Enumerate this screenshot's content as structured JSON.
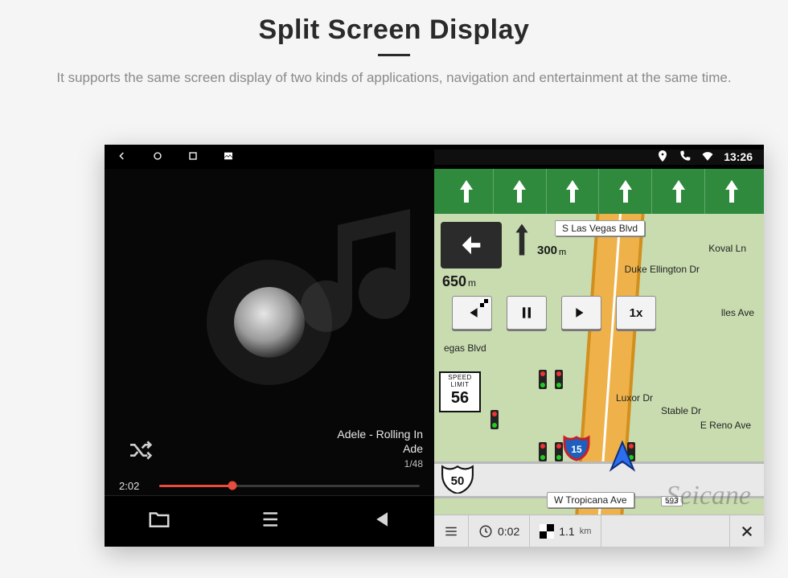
{
  "header": {
    "title": "Split Screen Display",
    "subtitle": "It supports the same screen display of two kinds of applications, navigation and entertainment at the same time."
  },
  "statusbar": {
    "time": "13:26"
  },
  "music": {
    "track_line1": "Adele - Rolling In",
    "track_line2": "Ade",
    "index": "1/48",
    "elapsed": "2:02"
  },
  "nav": {
    "street_top": "S Las Vegas Blvd",
    "street_bottom": "W Tropicana Ave",
    "exit_number": "593",
    "poi_1": "Duke Ellington Dr",
    "poi_2": "Koval Ln",
    "poi_3": "Luxor Dr",
    "poi_4": "E Reno Ave",
    "poi_5": "Stable Dr",
    "poi_6": "lles Ave",
    "poi_7": "egas Blvd",
    "turn_next_distance": "300",
    "turn_next_unit": "m",
    "turn_main_distance": "650",
    "turn_main_unit": "m",
    "speed_limit_label": "SPEED LIMIT",
    "speed_limit_value": "56",
    "route_shield": "50",
    "interstate": "15",
    "speed_btn": "1x",
    "bottom": {
      "time_val": "0:02",
      "dist_val": "1.1",
      "dist_unit": "km"
    }
  },
  "watermark": "Seicane"
}
